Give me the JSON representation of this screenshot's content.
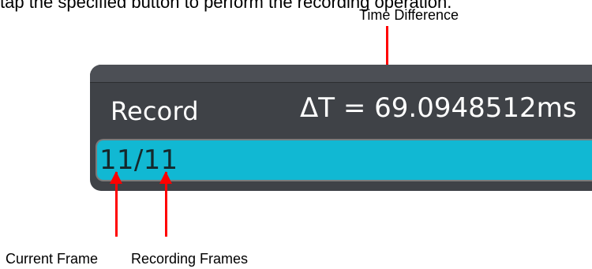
{
  "intro_text": "tap the specified button to perform the recording operation.",
  "annotations": {
    "time_difference": "Time Difference",
    "current_frame": "Current Frame",
    "recording_frames": "Recording Frames"
  },
  "panel": {
    "title": "Record",
    "delta_t": "ΔT = 69.0948512ms",
    "frame_counter": "11/11",
    "progress_fraction": 1.0
  },
  "colors": {
    "panel_bg": "#3f4247",
    "progress_fill": "#11b8d3",
    "arrow": "#ff0000"
  }
}
